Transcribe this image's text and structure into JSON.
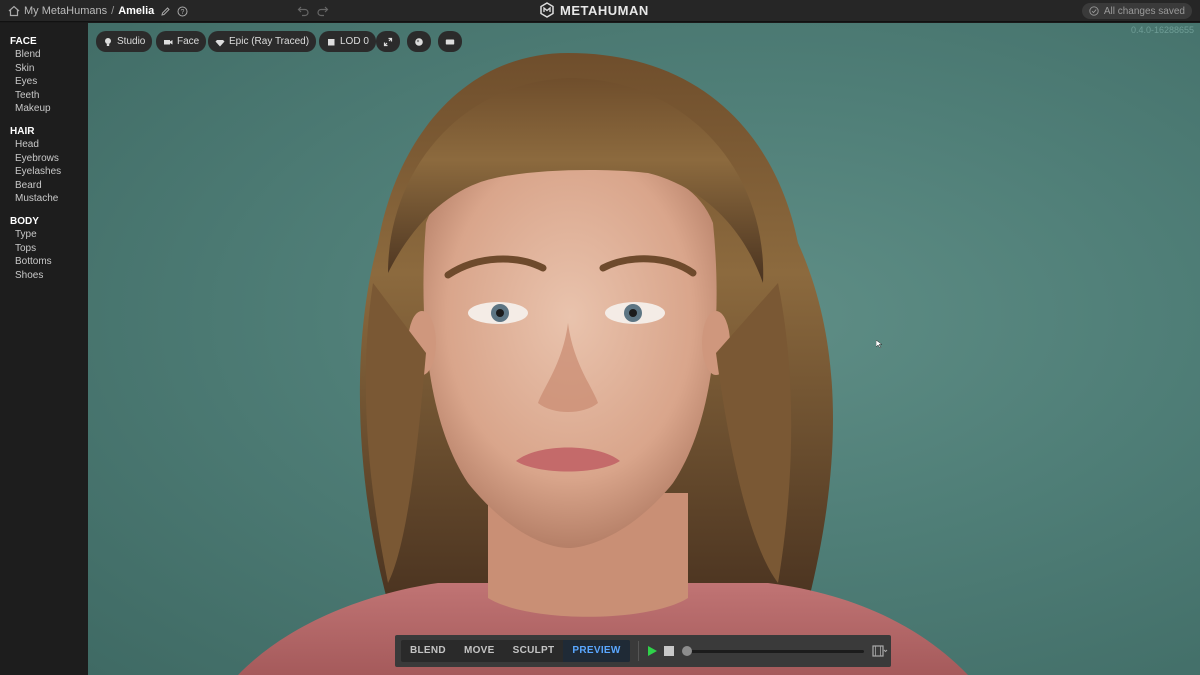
{
  "breadcrumb": {
    "root": "My MetaHumans",
    "separator": "/",
    "current": "Amelia"
  },
  "brand": {
    "name": "METAHUMAN"
  },
  "status": {
    "saved_label": "All changes saved"
  },
  "version": "0.4.0-16288655",
  "sidebar": {
    "sections": [
      {
        "title": "FACE",
        "items": [
          "Blend",
          "Skin",
          "Eyes",
          "Teeth",
          "Makeup"
        ]
      },
      {
        "title": "HAIR",
        "items": [
          "Head",
          "Eyebrows",
          "Eyelashes",
          "Beard",
          "Mustache"
        ]
      },
      {
        "title": "BODY",
        "items": [
          "Type",
          "Tops",
          "Bottoms",
          "Shoes"
        ]
      }
    ]
  },
  "viewport_chips": {
    "lighting": "Studio",
    "camera": "Face",
    "quality": "Epic (Ray Traced)",
    "lod": "LOD 0"
  },
  "modes": {
    "blend": "BLEND",
    "move": "MOVE",
    "sculpt": "SCULPT",
    "preview": "PREVIEW"
  },
  "icons": [
    "home-icon",
    "edit-icon",
    "help-icon",
    "undo-icon",
    "redo-icon",
    "metahuman-logo-icon",
    "check-circle-icon",
    "bulb-icon",
    "camera-icon",
    "gem-icon",
    "cube-icon",
    "expand-icon",
    "sphere-icon",
    "keyboard-icon",
    "play-icon",
    "stop-icon",
    "film-icon"
  ],
  "colors": {
    "accent": "#5aa7ff",
    "play": "#2fd24a",
    "viewport": "#5a8a83"
  }
}
